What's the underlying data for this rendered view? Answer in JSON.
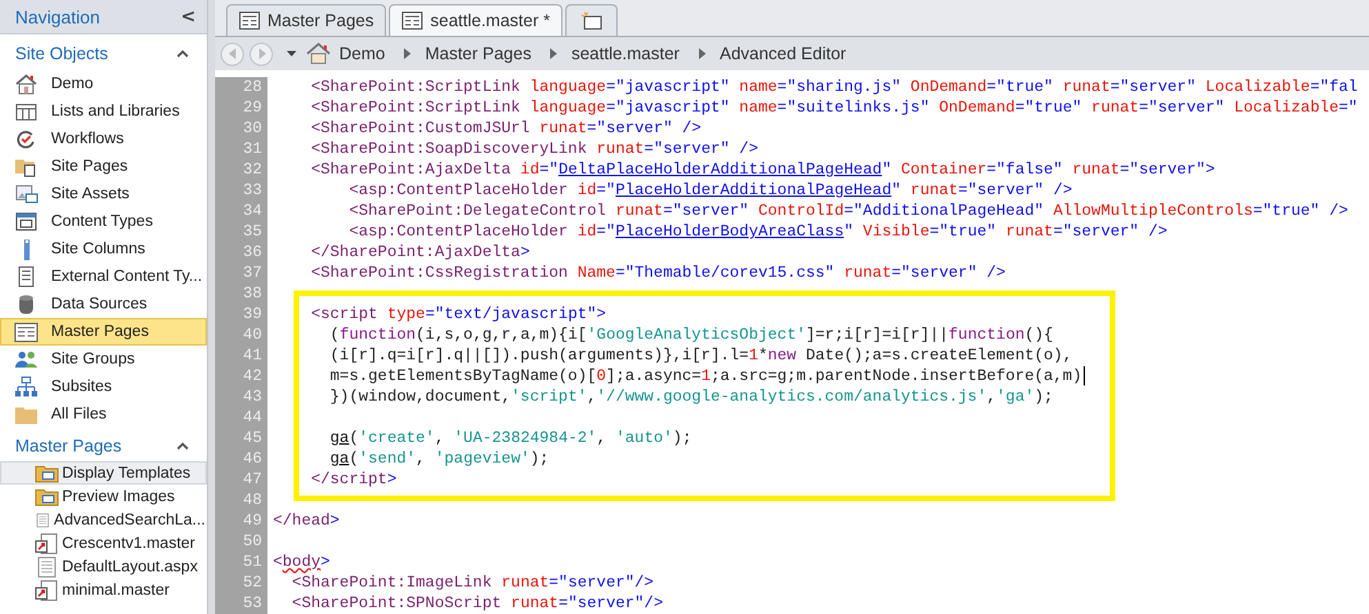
{
  "sidebar": {
    "title": "Navigation",
    "collapse_glyph": "<",
    "site_objects": {
      "title": "Site Objects",
      "expanded": true,
      "items": [
        {
          "label": "Demo",
          "selected": false
        },
        {
          "label": "Lists and Libraries",
          "selected": false
        },
        {
          "label": "Workflows",
          "selected": false
        },
        {
          "label": "Site Pages",
          "selected": false
        },
        {
          "label": "Site Assets",
          "selected": false
        },
        {
          "label": "Content Types",
          "selected": false
        },
        {
          "label": "Site Columns",
          "selected": false
        },
        {
          "label": "External Content Ty...",
          "selected": false
        },
        {
          "label": "Data Sources",
          "selected": false
        },
        {
          "label": "Master Pages",
          "selected": true
        },
        {
          "label": "Site Groups",
          "selected": false
        },
        {
          "label": "Subsites",
          "selected": false
        },
        {
          "label": "All Files",
          "selected": false
        }
      ]
    },
    "master_pages": {
      "title": "Master Pages",
      "expanded": true,
      "items": [
        {
          "kind": "folder",
          "label": "Display Templates",
          "selected": true
        },
        {
          "kind": "folder",
          "label": "Preview Images",
          "selected": false
        },
        {
          "kind": "file",
          "label": "AdvancedSearchLa...",
          "selected": false
        },
        {
          "kind": "master",
          "label": "Crescentv1.master",
          "selected": false
        },
        {
          "kind": "file",
          "label": "DefaultLayout.aspx",
          "selected": false
        },
        {
          "kind": "master",
          "label": "minimal.master",
          "selected": false
        }
      ]
    }
  },
  "tabs": [
    {
      "label": "Master Pages",
      "selected": false
    },
    {
      "label": "seattle.master *",
      "selected": true
    }
  ],
  "breadcrumb": [
    "Demo",
    "Master Pages",
    "seattle.master",
    "Advanced Editor"
  ],
  "editor": {
    "sections": [
      {
        "highlighted": false,
        "lines": [
          {
            "number": "28",
            "kind": "markup",
            "tokens": [
              {
                "kind": "tag",
                "text": "    <SharePoint:ScriptLink"
              },
              {
                "kind": "attr",
                "text": " language"
              },
              {
                "kind": "value",
                "text": "=\"javascript\""
              },
              {
                "kind": "attr",
                "text": " name"
              },
              {
                "kind": "value",
                "text": "=\"sharing.js\""
              },
              {
                "kind": "attr",
                "text": " OnDemand"
              },
              {
                "kind": "value",
                "text": "=\"true\""
              },
              {
                "kind": "attr",
                "text": " runat"
              },
              {
                "kind": "value",
                "text": "=\"server\""
              },
              {
                "kind": "attr",
                "text": " Localizable"
              },
              {
                "kind": "value",
                "text": "=\"fal"
              }
            ]
          },
          {
            "number": "29",
            "kind": "markup",
            "tokens": [
              {
                "kind": "tag",
                "text": "    <SharePoint:ScriptLink"
              },
              {
                "kind": "attr",
                "text": " language"
              },
              {
                "kind": "value",
                "text": "=\"javascript\""
              },
              {
                "kind": "attr",
                "text": " name"
              },
              {
                "kind": "value",
                "text": "=\"suitelinks.js\""
              },
              {
                "kind": "attr",
                "text": " OnDemand"
              },
              {
                "kind": "value",
                "text": "=\"true\""
              },
              {
                "kind": "attr",
                "text": " runat"
              },
              {
                "kind": "value",
                "text": "=\"server\""
              },
              {
                "kind": "attr",
                "text": " Localizable"
              },
              {
                "kind": "value",
                "text": "=\""
              }
            ]
          },
          {
            "number": "30",
            "kind": "markup",
            "tokens": [
              {
                "kind": "tag",
                "text": "    <SharePoint:CustomJSUrl"
              },
              {
                "kind": "attr",
                "text": " runat"
              },
              {
                "kind": "value",
                "text": "=\"server\" />"
              }
            ]
          },
          {
            "number": "31",
            "kind": "markup",
            "tokens": [
              {
                "kind": "tag",
                "text": "    <SharePoint:SoapDiscoveryLink"
              },
              {
                "kind": "attr",
                "text": " runat"
              },
              {
                "kind": "value",
                "text": "=\"server\" />"
              }
            ]
          },
          {
            "number": "32",
            "kind": "markup",
            "tokens": [
              {
                "kind": "tag",
                "text": "    <SharePoint:AjaxDelta"
              },
              {
                "kind": "attr",
                "text": " id"
              },
              {
                "kind": "value",
                "text": "=\""
              },
              {
                "kind": "link",
                "text": "DeltaPlaceHolderAdditionalPageHead"
              },
              {
                "kind": "value",
                "text": "\""
              },
              {
                "kind": "attr",
                "text": " Container"
              },
              {
                "kind": "value",
                "text": "=\"false\""
              },
              {
                "kind": "attr",
                "text": " runat"
              },
              {
                "kind": "value",
                "text": "=\"server\">"
              }
            ]
          },
          {
            "number": "33",
            "kind": "markup",
            "tokens": [
              {
                "kind": "tag",
                "text": "        <asp:ContentPlaceHolder"
              },
              {
                "kind": "attr",
                "text": " id"
              },
              {
                "kind": "value",
                "text": "=\""
              },
              {
                "kind": "link",
                "text": "PlaceHolderAdditionalPageHead"
              },
              {
                "kind": "value",
                "text": "\""
              },
              {
                "kind": "attr",
                "text": " runat"
              },
              {
                "kind": "value",
                "text": "=\"server\" />"
              }
            ]
          },
          {
            "number": "34",
            "kind": "markup",
            "tokens": [
              {
                "kind": "tag",
                "text": "        <SharePoint:DelegateControl"
              },
              {
                "kind": "attr",
                "text": " runat"
              },
              {
                "kind": "value",
                "text": "=\"server\""
              },
              {
                "kind": "attr",
                "text": " ControlId"
              },
              {
                "kind": "value",
                "text": "=\"AdditionalPageHead\""
              },
              {
                "kind": "attr",
                "text": " AllowMultipleControls"
              },
              {
                "kind": "value",
                "text": "=\"true\" />"
              }
            ]
          },
          {
            "number": "35",
            "kind": "markup",
            "tokens": [
              {
                "kind": "tag",
                "text": "        <asp:ContentPlaceHolder"
              },
              {
                "kind": "attr",
                "text": " id"
              },
              {
                "kind": "value",
                "text": "=\""
              },
              {
                "kind": "link",
                "text": "PlaceHolderBodyAreaClass"
              },
              {
                "kind": "value",
                "text": "\""
              },
              {
                "kind": "attr",
                "text": " Visible"
              },
              {
                "kind": "value",
                "text": "=\"true\""
              },
              {
                "kind": "attr",
                "text": " runat"
              },
              {
                "kind": "value",
                "text": "=\"server\" />"
              }
            ]
          },
          {
            "number": "36",
            "kind": "markup",
            "tokens": [
              {
                "kind": "tag",
                "text": "    </SharePoint:AjaxDelta"
              },
              {
                "kind": "value",
                "text": ">"
              }
            ]
          },
          {
            "number": "37",
            "kind": "markup",
            "tokens": [
              {
                "kind": "tag",
                "text": "    <SharePoint:CssRegistration"
              },
              {
                "kind": "attr",
                "text": " Name"
              },
              {
                "kind": "value",
                "text": "=\"Themable/corev15.css\""
              },
              {
                "kind": "attr",
                "text": " runat"
              },
              {
                "kind": "value",
                "text": "=\"server\" />"
              }
            ]
          }
        ]
      },
      {
        "highlighted": true,
        "lines": [
          {
            "number": "38",
            "kind": "markup"
          },
          {
            "number": "39",
            "kind": "markup",
            "tokens": [
              {
                "kind": "tag",
                "text": "    <script"
              },
              {
                "kind": "attr",
                "text": " type"
              },
              {
                "kind": "value",
                "text": "=\"text/javascript\">"
              }
            ]
          },
          {
            "number": "40",
            "kind": "script",
            "tokens": [
              {
                "kind": "plain",
                "text": "("
              },
              {
                "kind": "keyword",
                "text": "function"
              },
              {
                "kind": "plain",
                "text": "(i,s,o,g,r,a,m){i["
              },
              {
                "kind": "string",
                "text": "'GoogleAnalyticsObject'"
              },
              {
                "kind": "plain",
                "text": "]=r;i[r]=i[r]||"
              },
              {
                "kind": "keyword",
                "text": "function"
              },
              {
                "kind": "plain",
                "text": "(){"
              }
            ]
          },
          {
            "number": "41",
            "kind": "script",
            "tokens": [
              {
                "kind": "plain",
                "text": "(i[r].q=i[r].q||[]).push(arguments)},i[r].l="
              },
              {
                "kind": "number",
                "text": "1"
              },
              {
                "kind": "plain",
                "text": "*"
              },
              {
                "kind": "keyword",
                "text": "new"
              },
              {
                "kind": "plain",
                "text": " Date();a=s.createElement(o),"
              }
            ]
          },
          {
            "number": "42",
            "kind": "script",
            "tokens": [
              {
                "kind": "plain",
                "text": "m=s.getElementsByTagName(o)["
              },
              {
                "kind": "number",
                "text": "0"
              },
              {
                "kind": "plain",
                "text": "];a.async="
              },
              {
                "kind": "number",
                "text": "1"
              },
              {
                "kind": "plain",
                "text": ";a.src=g;m.parentNode.insertBefore(a,m)"
              },
              {
                "kind": "cursor"
              }
            ]
          },
          {
            "number": "43",
            "kind": "script",
            "tokens": [
              {
                "kind": "plain",
                "text": "})(window,document,"
              },
              {
                "kind": "string",
                "text": "'script'"
              },
              {
                "kind": "plain",
                "text": ","
              },
              {
                "kind": "string",
                "text": "'//www.google-analytics.com/analytics.js'"
              },
              {
                "kind": "plain",
                "text": ","
              },
              {
                "kind": "string",
                "text": "'ga'"
              },
              {
                "kind": "plain",
                "text": ");"
              }
            ]
          },
          {
            "number": "44",
            "kind": "script"
          },
          {
            "number": "45",
            "kind": "script",
            "tokens": [
              {
                "kind": "call",
                "text": "ga"
              },
              {
                "kind": "plain",
                "text": "("
              },
              {
                "kind": "string",
                "text": "'create'"
              },
              {
                "kind": "plain",
                "text": ", "
              },
              {
                "kind": "string",
                "text": "'UA-23824984-2'"
              },
              {
                "kind": "plain",
                "text": ", "
              },
              {
                "kind": "string",
                "text": "'auto'"
              },
              {
                "kind": "plain",
                "text": ");"
              }
            ]
          },
          {
            "number": "46",
            "kind": "script",
            "tokens": [
              {
                "kind": "call",
                "text": "ga"
              },
              {
                "kind": "plain",
                "text": "("
              },
              {
                "kind": "string",
                "text": "'send'"
              },
              {
                "kind": "plain",
                "text": ", "
              },
              {
                "kind": "string",
                "text": "'pageview'"
              },
              {
                "kind": "plain",
                "text": ");"
              }
            ]
          },
          {
            "number": "47",
            "kind": "markup",
            "tokens": [
              {
                "kind": "tag",
                "text": "    </script"
              },
              {
                "kind": "value",
                "text": ">"
              }
            ]
          },
          {
            "number": "48",
            "kind": "markup"
          }
        ]
      },
      {
        "highlighted": false,
        "lines": [
          {
            "number": "49",
            "kind": "markup",
            "tokens": [
              {
                "kind": "tag",
                "text": "</head"
              },
              {
                "kind": "value",
                "text": ">"
              }
            ]
          },
          {
            "number": "50",
            "kind": "markup"
          },
          {
            "number": "51",
            "kind": "markup",
            "tokens": [
              {
                "kind": "tag",
                "text": "<"
              },
              {
                "kind": "misspelled",
                "text": "body"
              },
              {
                "kind": "value",
                "text": ">"
              }
            ]
          },
          {
            "number": "52",
            "kind": "markup",
            "tokens": [
              {
                "kind": "tag",
                "text": "  <SharePoint:ImageLink"
              },
              {
                "kind": "attr",
                "text": " runat"
              },
              {
                "kind": "value",
                "text": "=\"server\"/>"
              }
            ]
          },
          {
            "number": "53",
            "kind": "markup",
            "tokens": [
              {
                "kind": "tag",
                "text": "  <SharePoint:SPNoScript"
              },
              {
                "kind": "attr",
                "text": " runat"
              },
              {
                "kind": "value",
                "text": "=\"server\"/>"
              }
            ]
          }
        ]
      }
    ]
  }
}
